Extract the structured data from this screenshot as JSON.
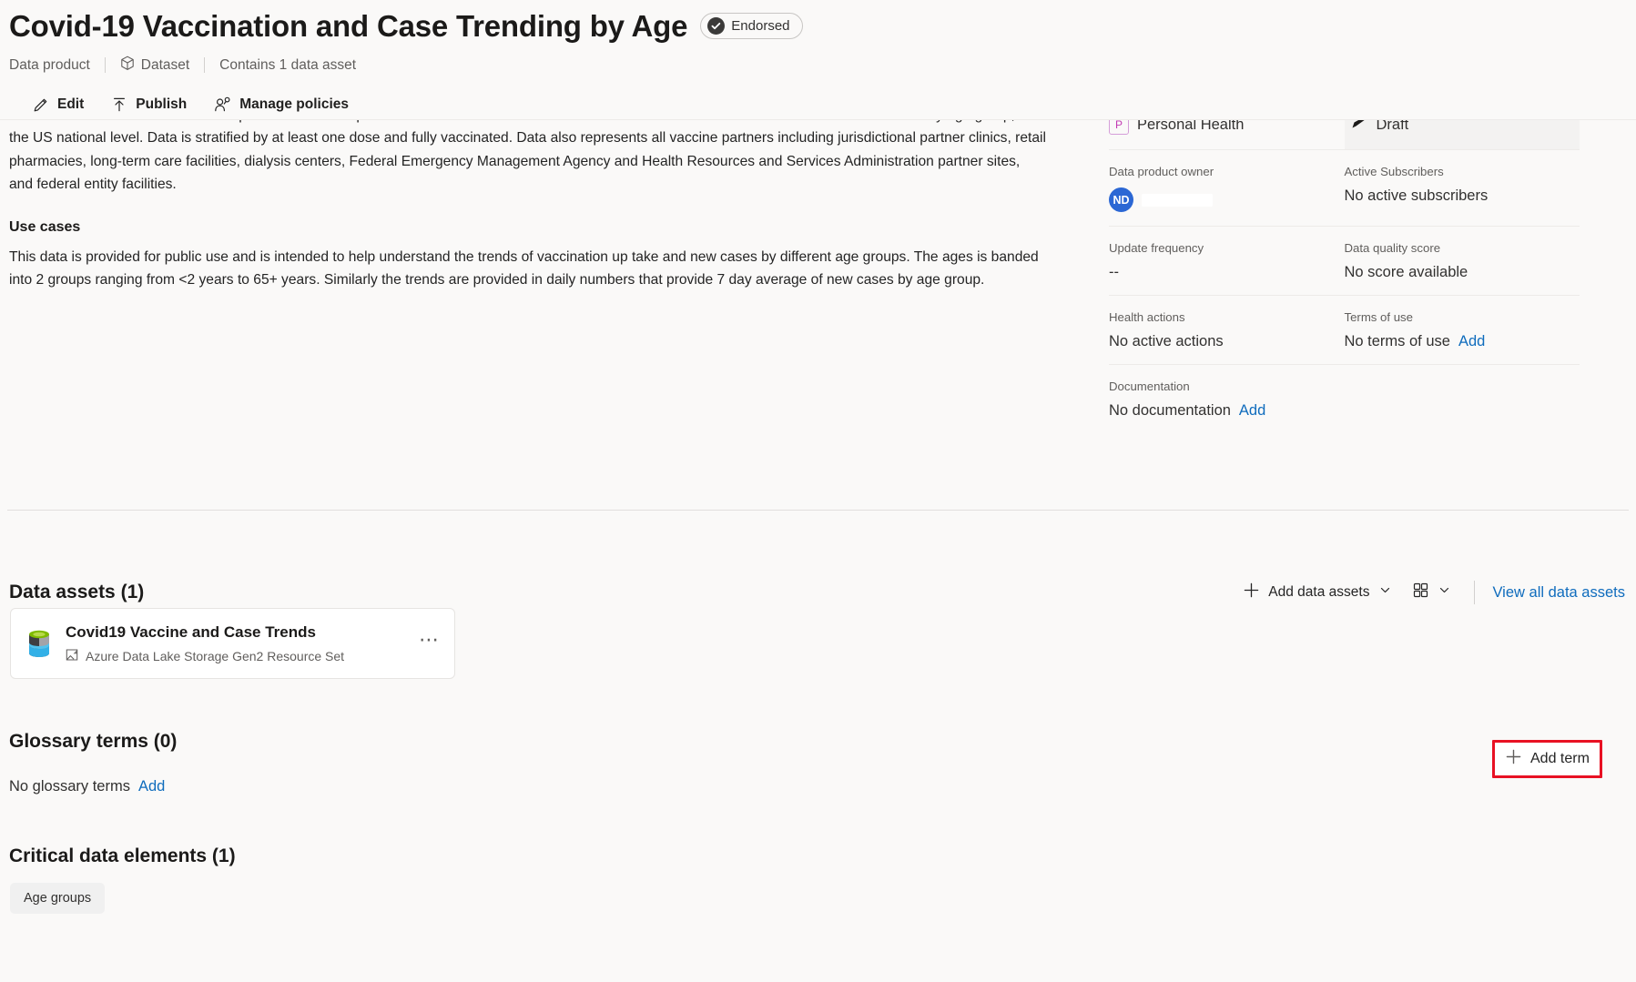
{
  "header": {
    "title": "Covid-19 Vaccination and Case Trending by Age",
    "endorsed_label": "Endorsed",
    "breadcrumb": {
      "kind": "Data product",
      "type": "Dataset",
      "asset_count": "Contains 1 data asset"
    }
  },
  "commands": [
    {
      "label": "Edit",
      "icon": "pencil-icon"
    },
    {
      "label": "Publish",
      "icon": "publish-arrow-icon"
    },
    {
      "label": "Manage policies",
      "icon": "person-key-icon"
    }
  ],
  "description": {
    "paragraph_clipped": "This data comes from the CDC as a part of the U.S. Department of Health & Human Services.  The data contains trends in vaccinations and cases by age group, at the US national level. Data is stratified by at least one dose and fully vaccinated. Data also represents all vaccine partners including jurisdictional partner clinics, retail pharmacies, long-term care facilities, dialysis centers, Federal Emergency Management Agency and Health Resources and Services Administration partner sites, and federal entity facilities.",
    "use_cases_heading": "Use cases",
    "use_cases_body": "This data is provided for public use and is intended to help understand the trends of vaccination up take and new cases by different age groups.  The ages is banded into 2 groups ranging from <2 years to 65+ years.  Similarly the trends are provided in daily numbers that provide 7 day average of new cases by age group."
  },
  "metadata": {
    "classification_value": "Personal Health",
    "classification_tag": "P",
    "status_value": "Draft",
    "owner_label": "Data product owner",
    "owner_initials": "ND",
    "subscribers_label": "Active Subscribers",
    "subscribers_value": "No active subscribers",
    "update_frequency_label": "Update frequency",
    "update_frequency_value": "--",
    "quality_label": "Data quality score",
    "quality_value": "No score available",
    "health_label": "Health actions",
    "health_value": "No active actions",
    "terms_label": "Terms of use",
    "terms_value": "No terms of use",
    "terms_add": "Add",
    "documentation_label": "Documentation",
    "documentation_value": "No documentation",
    "documentation_add": "Add"
  },
  "data_assets": {
    "heading": "Data assets (1)",
    "add_label": "Add data assets",
    "view_all_label": "View all data assets",
    "items": [
      {
        "name": "Covid19 Vaccine and Case Trends",
        "type": "Azure Data Lake Storage Gen2 Resource Set"
      }
    ]
  },
  "glossary": {
    "heading": "Glossary terms (0)",
    "empty_text": "No glossary terms",
    "add_link": "Add",
    "add_term_button": "Add term"
  },
  "critical_data_elements": {
    "heading": "Critical data elements (1)",
    "items": [
      "Age groups"
    ]
  },
  "colors": {
    "link": "#0f6cbd",
    "annotation": "#e81123",
    "avatar": "#2b67d4",
    "classification_tag": "#c239b3",
    "page_background": "#faf9f8"
  }
}
